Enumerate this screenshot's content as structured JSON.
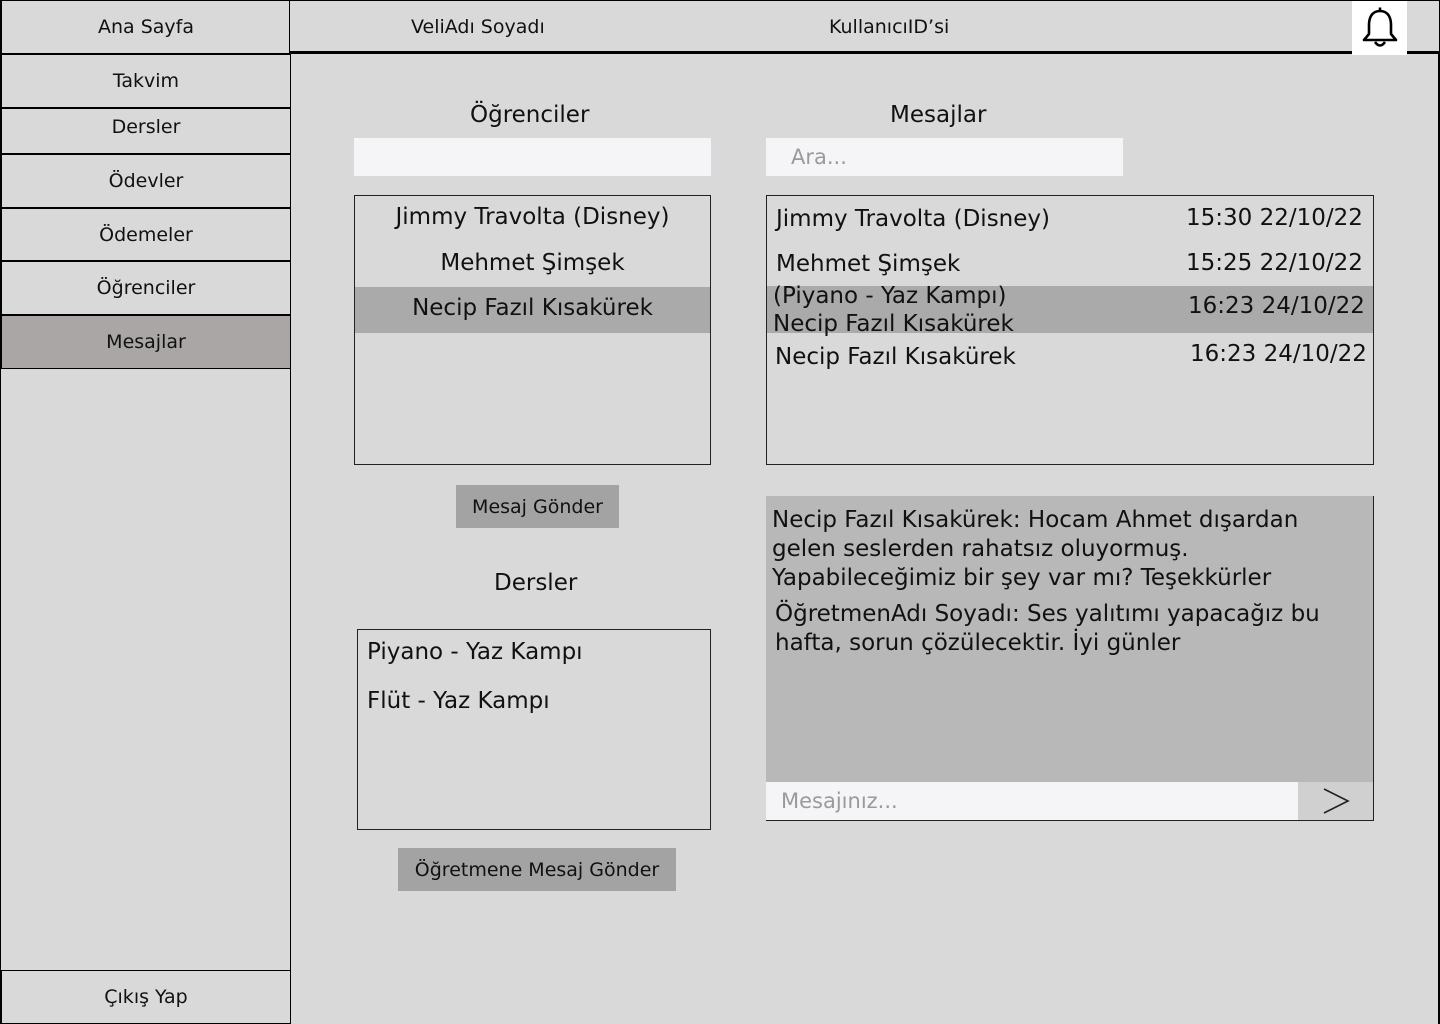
{
  "header": {
    "parent_name": "VeliAdı Soyadı",
    "user_id": "KullanıcıID’si",
    "bell_icon": "bell-icon"
  },
  "sidebar": {
    "home": "Ana Sayfa",
    "items": [
      {
        "label": "Takvim"
      },
      {
        "label": "Dersler"
      },
      {
        "label": "Ödevler"
      },
      {
        "label": "Ödemeler"
      },
      {
        "label": "Öğrenciler"
      },
      {
        "label": "Mesajlar",
        "active": true
      }
    ],
    "logout": "Çıkış Yap"
  },
  "students": {
    "title": "Öğrenciler",
    "search_placeholder": "",
    "items": [
      {
        "name": "Jimmy Travolta (Disney)"
      },
      {
        "name": "Mehmet Şimşek"
      },
      {
        "name": "Necip Fazıl Kısakürek",
        "selected": true
      }
    ],
    "send_button": "Mesaj Gönder"
  },
  "courses": {
    "title": "Dersler",
    "items": [
      {
        "name": "Piyano - Yaz Kampı"
      },
      {
        "name": "Flüt - Yaz Kampı"
      }
    ],
    "send_button": "Öğretmene Mesaj Gönder"
  },
  "messages": {
    "title": "Mesajlar",
    "search_placeholder": "Ara...",
    "items": [
      {
        "name": "Jimmy Travolta (Disney)",
        "time": "15:30 22/10/22"
      },
      {
        "name": "Mehmet Şimşek",
        "time": "15:25 22/10/22"
      },
      {
        "course": "(Piyano - Yaz Kampı)",
        "name": "Necip Fazıl Kısakürek",
        "time": "16:23 24/10/22",
        "selected": true
      },
      {
        "name": "Necip Fazıl Kısakürek",
        "time": "16:23 24/10/22"
      }
    ]
  },
  "chat": {
    "messages": [
      {
        "lines": [
          "Necip Fazıl Kısakürek: Hocam Ahmet dışardan",
          "gelen seslerden rahatsız oluyormuş.",
          "Yapabileceğimiz bir şey var mı? Teşekkürler"
        ]
      },
      {
        "lines": [
          "ÖğretmenAdı Soyadı: Ses yalıtımı yapacağız bu",
          "hafta, sorun çözülecektir. İyi günler"
        ]
      }
    ],
    "input_placeholder": "Mesajınız...",
    "send_icon": "chevron-right-icon"
  },
  "colors": {
    "background": "#d9d9d9",
    "active_sidebar": "#aaa6a6",
    "selected_row": "#aaaaaa",
    "button": "#a3a3a3",
    "chat_area": "#b8b8b8",
    "input": "#f5f4f6"
  }
}
